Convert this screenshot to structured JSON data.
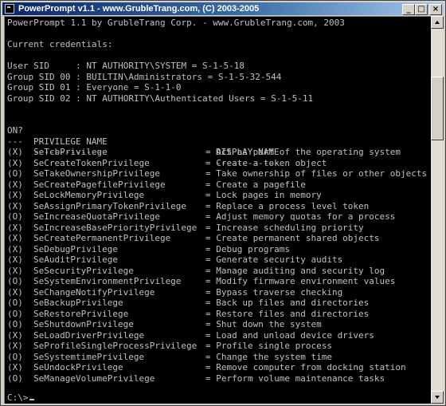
{
  "window": {
    "title": "PowerPrompt v1.1 - www.GrubleTrang.com, (C) 2003-2005",
    "minimize_glyph": "_",
    "maximize_glyph": "□",
    "close_glyph": "×"
  },
  "console": {
    "banner": "PowerPrompt 1.1 by GrubleTrang Corp. - www.GrubleTrang.com, 2003",
    "credentials_heading": "Current credentials:",
    "credentials": [
      "User SID     : NT AUTHORITY\\SYSTEM = S-1-5-18",
      "Group SID 00 : BUILTIN\\Administrators = S-1-5-32-544",
      "Group SID 01 : Everyone = S-1-1-0",
      "Group SID 02 : NT AUTHORITY\\Authenticated Users = S-1-5-11"
    ],
    "header": {
      "on": "ON?",
      "name": "PRIVILEGE NAME",
      "desc": "DISPLAY NAME"
    },
    "underline": {
      "on": "---",
      "name": "--------------",
      "desc": "------------"
    },
    "privileges": [
      {
        "on": "(X)",
        "name": "SeTcbPrivilege",
        "desc": "= Act as part of the operating system"
      },
      {
        "on": "(X)",
        "name": "SeCreateTokenPrivilege",
        "desc": "= Create a token object"
      },
      {
        "on": "(O)",
        "name": "SeTakeOwnershipPrivilege",
        "desc": "= Take ownership of files or other objects"
      },
      {
        "on": "(X)",
        "name": "SeCreatePagefilePrivilege",
        "desc": "= Create a pagefile"
      },
      {
        "on": "(X)",
        "name": "SeLockMemoryPrivilege",
        "desc": "= Lock pages in memory"
      },
      {
        "on": "(X)",
        "name": "SeAssignPrimaryTokenPrivilege",
        "desc": "= Replace a process level token"
      },
      {
        "on": "(O)",
        "name": "SeIncreaseQuotaPrivilege",
        "desc": "= Adjust memory quotas for a process"
      },
      {
        "on": "(X)",
        "name": "SeIncreaseBasePriorityPrivilege",
        "desc": "= Increase scheduling priority"
      },
      {
        "on": "(X)",
        "name": "SeCreatePermanentPrivilege",
        "desc": "= Create permanent shared objects"
      },
      {
        "on": "(X)",
        "name": "SeDebugPrivilege",
        "desc": "= Debug programs"
      },
      {
        "on": "(X)",
        "name": "SeAuditPrivilege",
        "desc": "= Generate security audits"
      },
      {
        "on": "(X)",
        "name": "SeSecurityPrivilege",
        "desc": "= Manage auditing and security log"
      },
      {
        "on": "(O)",
        "name": "SeSystemEnvironmentPrivilege",
        "desc": "= Modify firmware environment values"
      },
      {
        "on": "(X)",
        "name": "SeChangeNotifyPrivilege",
        "desc": "= Bypass traverse checking"
      },
      {
        "on": "(O)",
        "name": "SeBackupPrivilege",
        "desc": "= Back up files and directories"
      },
      {
        "on": "(O)",
        "name": "SeRestorePrivilege",
        "desc": "= Restore files and directories"
      },
      {
        "on": "(O)",
        "name": "SeShutdownPrivilege",
        "desc": "= Shut down the system"
      },
      {
        "on": "(X)",
        "name": "SeLoadDriverPrivilege",
        "desc": "= Load and unload device drivers"
      },
      {
        "on": "(X)",
        "name": "SeProfileSingleProcessPrivilege",
        "desc": "= Profile single process"
      },
      {
        "on": "(O)",
        "name": "SeSystemtimePrivilege",
        "desc": "= Change the system time"
      },
      {
        "on": "(X)",
        "name": "SeUndockPrivilege",
        "desc": "= Remove computer from docking station"
      },
      {
        "on": "(O)",
        "name": "SeManageVolumePrivilege",
        "desc": "= Perform volume maintenance tasks"
      }
    ],
    "prompt": "C:\\>"
  },
  "colors": {
    "console_bg": "#000000",
    "console_fg": "#c0c0c0",
    "titlebar_start": "#0a246a",
    "titlebar_end": "#a6caf0"
  },
  "icons": {
    "window_icon": "console-window-icon",
    "scroll_up": "arrow-up-icon",
    "scroll_down": "arrow-down-icon"
  }
}
